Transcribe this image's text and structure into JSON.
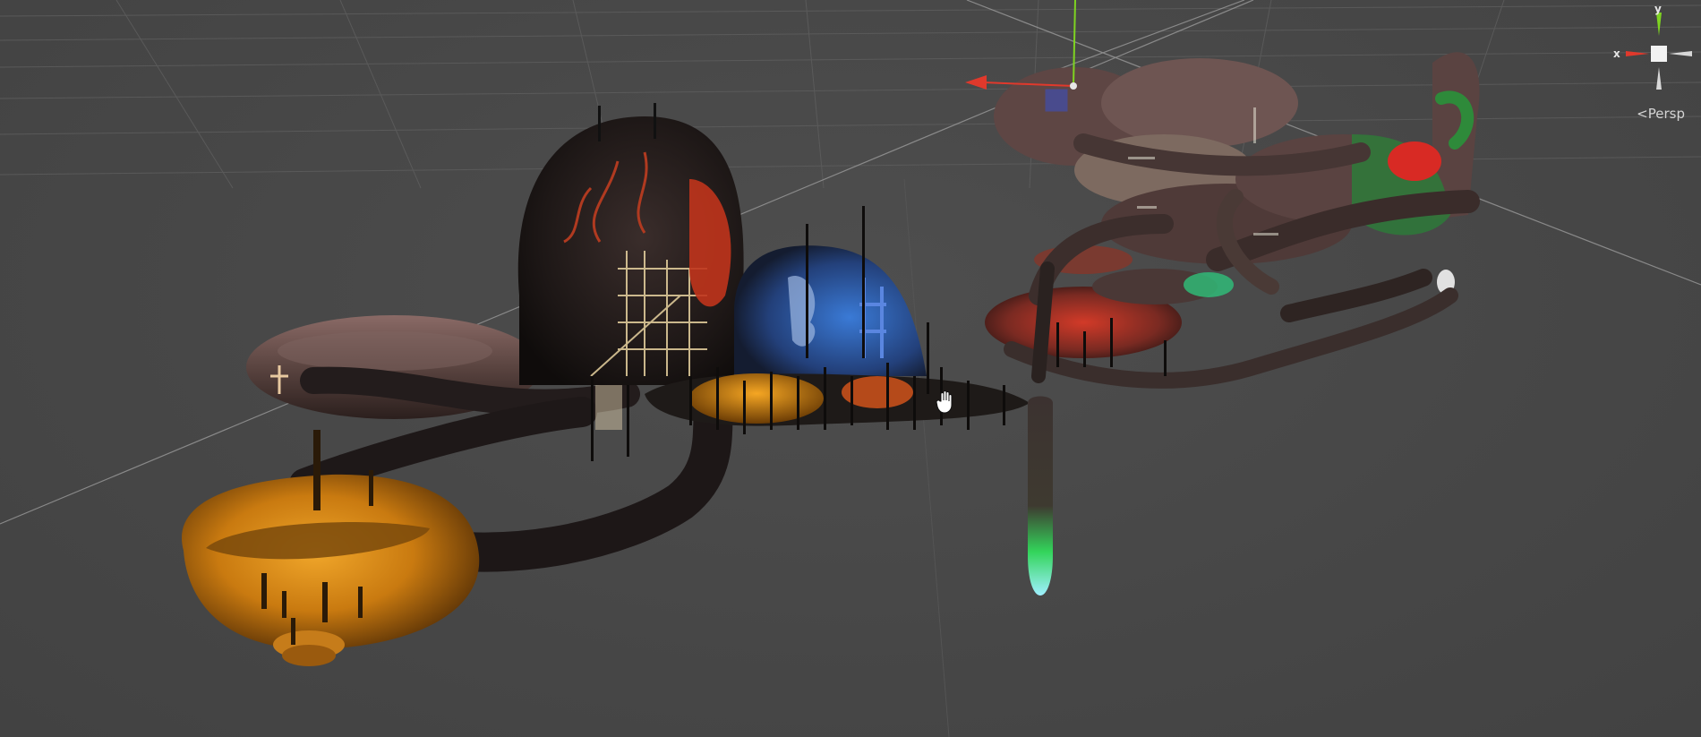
{
  "scene_view": {
    "projection_label": "Persp",
    "gizmo": {
      "x_label": "x",
      "y_label": "y",
      "x_color": "#e0392c",
      "y_color": "#7ed321",
      "z_color": "#d8d8d8",
      "center_color": "#f2f2f2"
    },
    "move_tool": {
      "x_axis_color": "#e0392c",
      "y_axis_color": "#7ed321",
      "plane_handle_color": "#3c4fbf"
    },
    "background_color": "#474747",
    "grid_color": "#5c5c5c"
  },
  "icons": {
    "cursor": "hand-pan-cursor-icon",
    "projection_arrow": "perspective-arrow-icon"
  }
}
